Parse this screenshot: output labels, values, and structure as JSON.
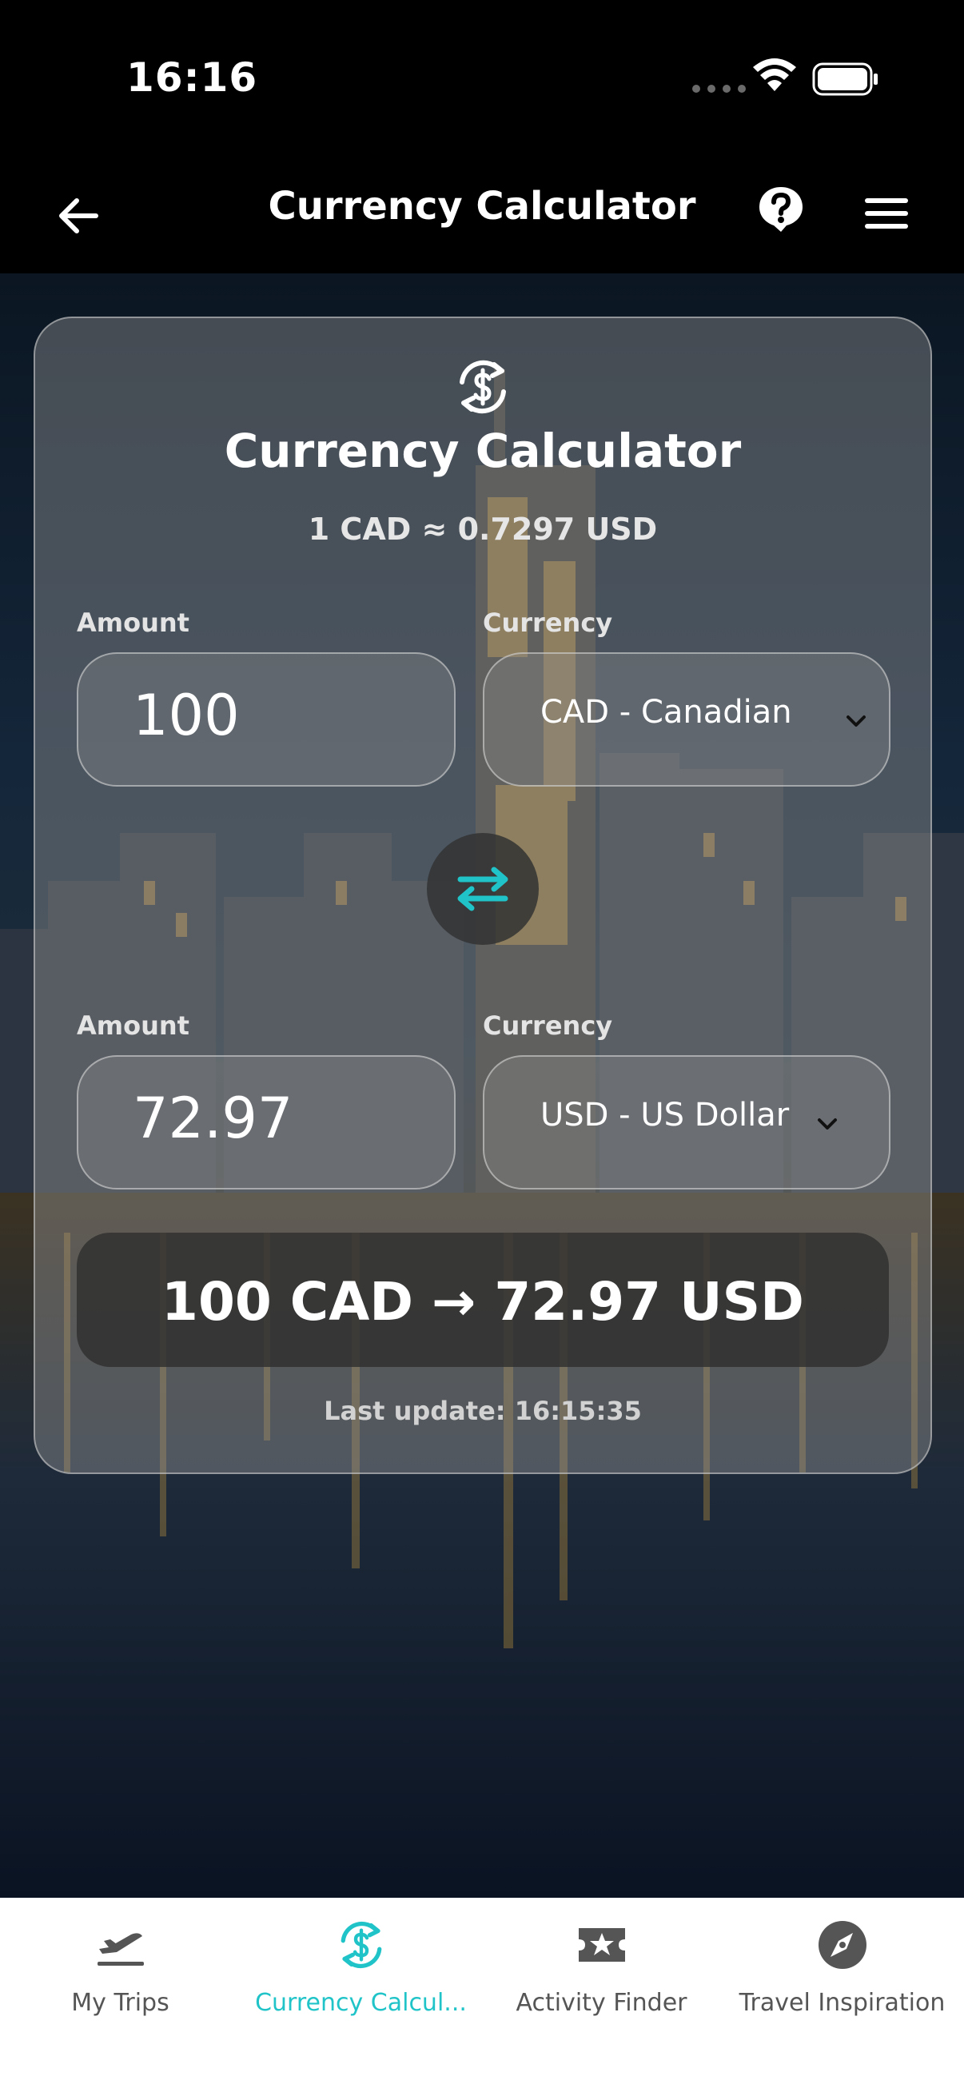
{
  "status_bar": {
    "time": "16:16"
  },
  "header": {
    "title": "Currency Calculator",
    "back_icon": "arrow-left-icon",
    "help_icon": "question-bubble-icon",
    "menu_icon": "hamburger-menu-icon"
  },
  "calculator": {
    "icon": "currency-exchange-icon",
    "title": "Currency Calculator",
    "rate": "1 CAD ≈ 0.7297 USD",
    "from": {
      "amount_label": "Amount",
      "amount": "100",
      "currency_label": "Currency",
      "currency": "CAD - Canadian"
    },
    "to": {
      "amount_label": "Amount",
      "amount": "72.97",
      "currency_label": "Currency",
      "currency": "USD - US Dollar"
    },
    "swap_icon": "swap-arrows-icon",
    "result": "100 CAD → 72.97 USD",
    "last_update": "Last update: 16:15:35"
  },
  "tabs": [
    {
      "label": "My Trips",
      "icon": "plane-departure-icon",
      "active": false
    },
    {
      "label": "Currency Calcul...",
      "icon": "currency-exchange-icon",
      "active": true
    },
    {
      "label": "Activity Finder",
      "icon": "star-ticket-icon",
      "active": false
    },
    {
      "label": "Travel Inspiration",
      "icon": "compass-icon",
      "active": false
    }
  ],
  "colors": {
    "accent": "#20c4c8",
    "background": "#000000",
    "tab_inactive": "#555555"
  }
}
